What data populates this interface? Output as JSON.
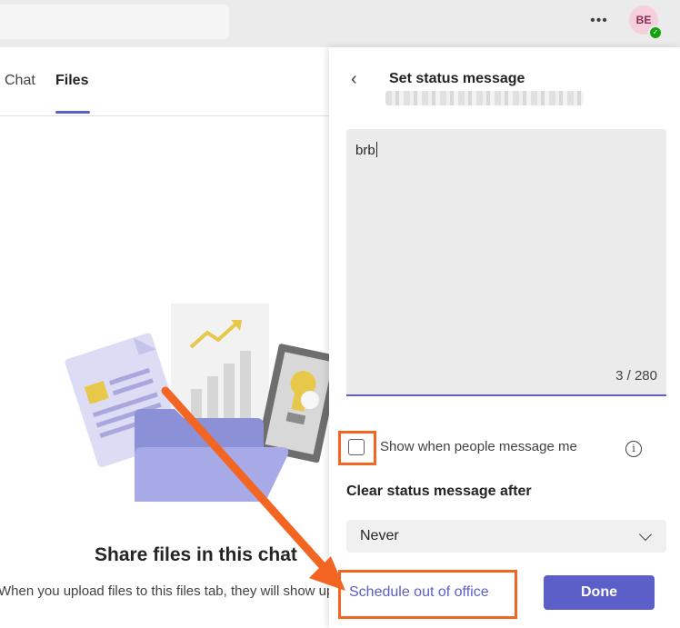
{
  "header": {
    "avatar_initials": "BE"
  },
  "tabs": {
    "chat": "Chat",
    "files": "Files"
  },
  "empty_state": {
    "title": "Share files in this chat",
    "body": "When you upload files to this files tab, they will show up here"
  },
  "panel": {
    "title": "Set status message",
    "message_value": "brb",
    "counter": "3 / 280",
    "show_when_label": "Show when people message me",
    "clear_after_label": "Clear status message after",
    "clear_after_value": "Never",
    "schedule_label": "Schedule out of office",
    "done_label": "Done"
  },
  "colors": {
    "accent": "#5b5fc7",
    "annotation": "#f26522",
    "presence": "#13a10e"
  }
}
